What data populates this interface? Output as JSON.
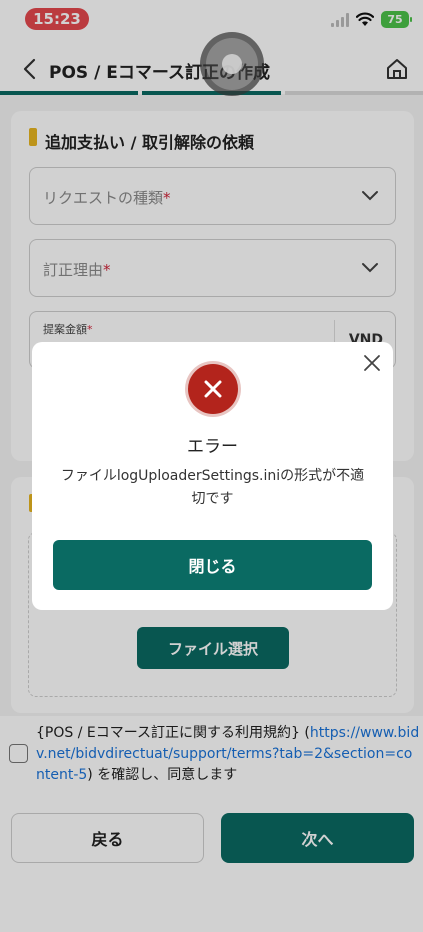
{
  "status_bar": {
    "time": "15:23",
    "battery": "75"
  },
  "header": {
    "title": "POS / Eコマース訂正の作成",
    "back_icon": "chevron-left-icon",
    "home_icon": "home-icon"
  },
  "colors": {
    "primary": "#0a6a62",
    "accent": "#e7b520",
    "error": "#b3241c",
    "link": "#1a73d9",
    "progress_inactive": "#d9d9d9"
  },
  "progress": {
    "total_steps": 3,
    "current_step": 2
  },
  "section1": {
    "title": "追加支払い / 取引解除の依頼",
    "request_type": {
      "placeholder": "リクエストの種類",
      "required": "*"
    },
    "reason": {
      "placeholder": "訂正理由",
      "required": "*"
    },
    "amount": {
      "label": "提案金額",
      "required": "*",
      "currency": "VND"
    }
  },
  "section2": {
    "file_button": "ファイル選択"
  },
  "terms": {
    "prefix": "{POS / Eコマース訂正に関する利用規約} (",
    "link": "https://www.bidv.net/bidvdirectuat/support/terms?tab=2&section=content-5",
    "suffix": ") を確認し、同意します"
  },
  "footer": {
    "back": "戻る",
    "next": "次へ"
  },
  "modal": {
    "title": "エラー",
    "message": "ファイルlogUploaderSettings.iniの形式が不適切です",
    "close_button": "閉じる"
  }
}
